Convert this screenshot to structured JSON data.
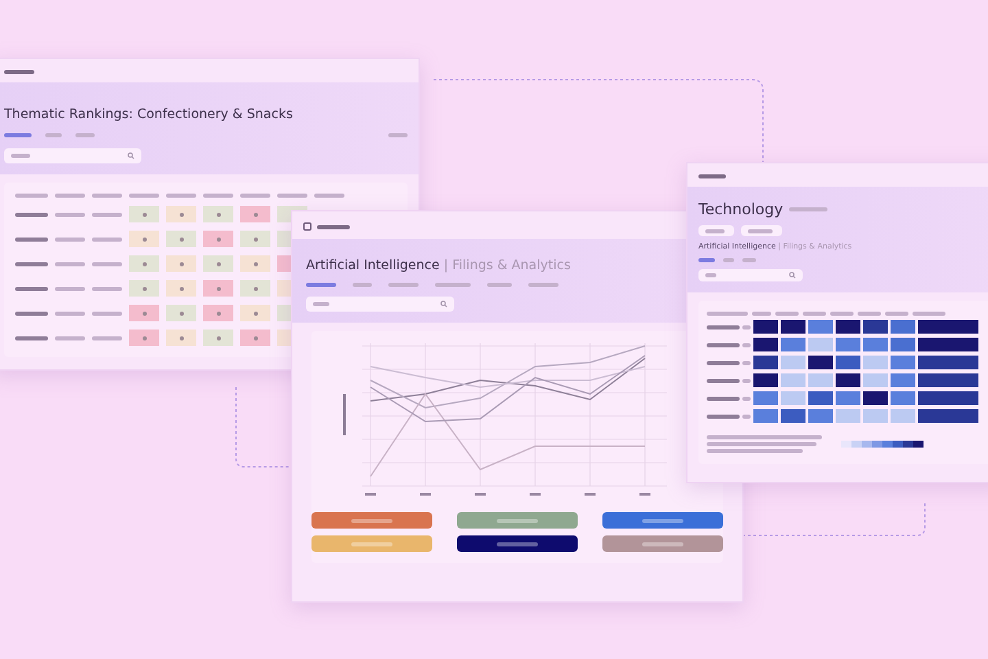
{
  "rankings_window": {
    "title": "Thematic Rankings: Confectionery & Snacks",
    "rows": [
      {
        "cells": [
          {
            "color": "#e3e4d6"
          },
          {
            "color": "#f6e2d4"
          },
          {
            "color": "#e3e4d6"
          },
          {
            "color": "#f4bccd"
          },
          {
            "color": "#e3e4d6"
          }
        ]
      },
      {
        "cells": [
          {
            "color": "#f6e2d4"
          },
          {
            "color": "#e3e4d6"
          },
          {
            "color": "#f4bccd"
          },
          {
            "color": "#e3e4d6"
          },
          {
            "color": "#e3e4d6"
          }
        ]
      },
      {
        "cells": [
          {
            "color": "#e3e4d6"
          },
          {
            "color": "#f6e2d4"
          },
          {
            "color": "#e3e4d6"
          },
          {
            "color": "#f6e2d4"
          },
          {
            "color": "#f4bccd"
          }
        ]
      },
      {
        "cells": [
          {
            "color": "#e3e4d6"
          },
          {
            "color": "#f6e2d4"
          },
          {
            "color": "#f4bccd"
          },
          {
            "color": "#e3e4d6"
          },
          {
            "color": "#f6e2d4"
          }
        ]
      },
      {
        "cells": [
          {
            "color": "#f4bccd"
          },
          {
            "color": "#e3e4d6"
          },
          {
            "color": "#f4bccd"
          },
          {
            "color": "#f6e2d4"
          },
          {
            "color": "#e3e4d6"
          }
        ]
      },
      {
        "cells": [
          {
            "color": "#f4bccd"
          },
          {
            "color": "#f6e2d4"
          },
          {
            "color": "#e3e4d6"
          },
          {
            "color": "#f4bccd"
          },
          {
            "color": "#f6e2d4"
          }
        ]
      }
    ]
  },
  "analytics_window": {
    "title": "Artificial Intelligence",
    "subtitle": "| Filings & Analytics",
    "legend": [
      {
        "color": "#d9744f"
      },
      {
        "color": "#8fa890"
      },
      {
        "color": "#3b6fd8"
      },
      {
        "color": "#e9b66c"
      },
      {
        "color": "#0e0b6e"
      },
      {
        "color": "#b29499"
      }
    ]
  },
  "technology_window": {
    "title": "Technology",
    "subtitle_main": "Artificial Intelligence",
    "subtitle_rest": "| Filings & Analytics",
    "heatmap": [
      {
        "cells": [
          {
            "color": "#1a1670"
          },
          {
            "color": "#1a1670"
          },
          {
            "color": "#5a7fdc"
          },
          {
            "color": "#1a1670"
          },
          {
            "color": "#2a3896"
          },
          {
            "color": "#4a6fd0"
          },
          {
            "color": "#1a1670"
          }
        ]
      },
      {
        "cells": [
          {
            "color": "#1a1670"
          },
          {
            "color": "#5a7fdc"
          },
          {
            "color": "#bccaf2"
          },
          {
            "color": "#5a7fdc"
          },
          {
            "color": "#5a7fdc"
          },
          {
            "color": "#4a6fd0"
          },
          {
            "color": "#1a1670"
          }
        ]
      },
      {
        "cells": [
          {
            "color": "#2a3896"
          },
          {
            "color": "#bccaf2"
          },
          {
            "color": "#1a1670"
          },
          {
            "color": "#3c5cc0"
          },
          {
            "color": "#bccaf2"
          },
          {
            "color": "#5a7fdc"
          },
          {
            "color": "#2a3896"
          }
        ]
      },
      {
        "cells": [
          {
            "color": "#1a1670"
          },
          {
            "color": "#bccaf2"
          },
          {
            "color": "#bccaf2"
          },
          {
            "color": "#1a1670"
          },
          {
            "color": "#bccaf2"
          },
          {
            "color": "#5a7fdc"
          },
          {
            "color": "#2a3896"
          }
        ]
      },
      {
        "cells": [
          {
            "color": "#5a7fdc"
          },
          {
            "color": "#bccaf2"
          },
          {
            "color": "#3c5cc0"
          },
          {
            "color": "#5a7fdc"
          },
          {
            "color": "#1a1670"
          },
          {
            "color": "#5a7fdc"
          },
          {
            "color": "#2a3896"
          }
        ]
      },
      {
        "cells": [
          {
            "color": "#5a7fdc"
          },
          {
            "color": "#3c5cc0"
          },
          {
            "color": "#5a7fdc"
          },
          {
            "color": "#bccaf2"
          },
          {
            "color": "#bccaf2"
          },
          {
            "color": "#bccaf2"
          },
          {
            "color": "#2a3896"
          }
        ]
      }
    ]
  }
}
